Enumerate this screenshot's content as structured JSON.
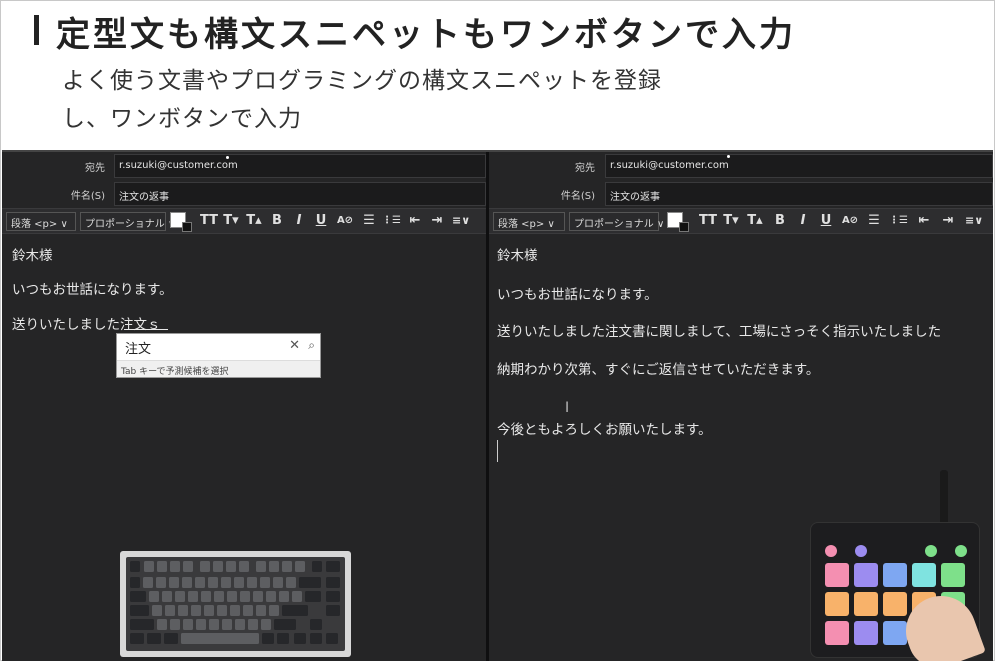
{
  "header": {
    "title": "定型文も構文スニペットもワンボタンで入力",
    "subtitle_line1": "よく使う文書やプログラミングの構文スニペットを登録",
    "subtitle_line2": "し、ワンボタンで入力"
  },
  "left": {
    "to_label": "宛先",
    "to_value": "r.suzuki@customer.com",
    "subject_label": "件名(S)",
    "subject_value": "注文の返事",
    "paragraph_select": "段落 <p> ∨",
    "font_select": "プロポーショナル ∨",
    "lines": [
      "鈴木様",
      "いつもお世話になります。",
      "送りいたしました注文ｓ"
    ],
    "autocomplete": {
      "input": "注文",
      "hint": "Tab キーで予測候補を選択"
    }
  },
  "right": {
    "to_label": "宛先",
    "to_value": "r.suzuki@customer.com",
    "subject_label": "件名(S)",
    "subject_value": "注文の返事",
    "paragraph_select": "段落 <p> ∨",
    "font_select": "プロポーショナル ∨",
    "lines": [
      "鈴木様",
      "いつもお世話になります。",
      "送りいたしました注文書に関しまして、工場にさっそく指示いたしました",
      "納期わかり次第、すぐにご返信させていただきます。",
      "今後ともよろしくお願いたします。"
    ],
    "cursor": "I"
  },
  "toolbar_icons": [
    "TT",
    "T▾",
    "T▴",
    "B",
    "I",
    "U",
    "A⊘",
    "☰",
    "⋮☰",
    "⇤",
    "⇥",
    "≡∨"
  ],
  "pad_colors": {
    "pink": "#f48fb1",
    "purple": "#9c8cf0",
    "blue": "#7ea7f2",
    "cyan": "#7fe3e0",
    "green": "#7ee08a",
    "orange": "#f8b26a"
  }
}
